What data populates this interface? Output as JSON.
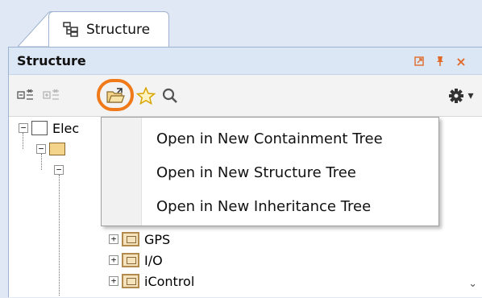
{
  "tab": {
    "label": "Structure"
  },
  "panel": {
    "title": "Structure",
    "controls": {
      "pin": "pin-icon",
      "float": "float-icon",
      "close": "×"
    }
  },
  "toolbar": {
    "tools": [
      "collapse-all-icon",
      "expand-all-icon",
      "open-folder-icon",
      "star-icon",
      "search-icon",
      "gear-icon"
    ]
  },
  "tree": {
    "root_label": "Elec",
    "items": [
      {
        "label": "GPS"
      },
      {
        "label": "I/O"
      },
      {
        "label": "iControl"
      }
    ]
  },
  "menu": {
    "items": [
      {
        "label": "Open in New Containment Tree"
      },
      {
        "label": "Open in New Structure Tree"
      },
      {
        "label": "Open in New Inheritance Tree"
      }
    ]
  },
  "colors": {
    "highlight": "#f07a1a",
    "background": "#dfe8f4",
    "titlebar": "#dce7f5"
  }
}
